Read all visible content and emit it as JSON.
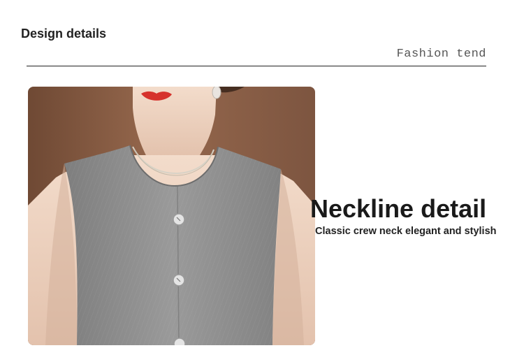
{
  "section": {
    "title": "Design details",
    "tagline": "Fashion tend"
  },
  "feature": {
    "headline": "Neckline detail",
    "description": "Classic crew neck elegant and stylish"
  },
  "photo": {
    "subject": "model-wearing-gray-sleeveless-vest",
    "colors": {
      "background": "#8a5e45",
      "vest": "#8f8f8f",
      "skin": "#ecd2bf",
      "lips": "#d6322c"
    }
  }
}
